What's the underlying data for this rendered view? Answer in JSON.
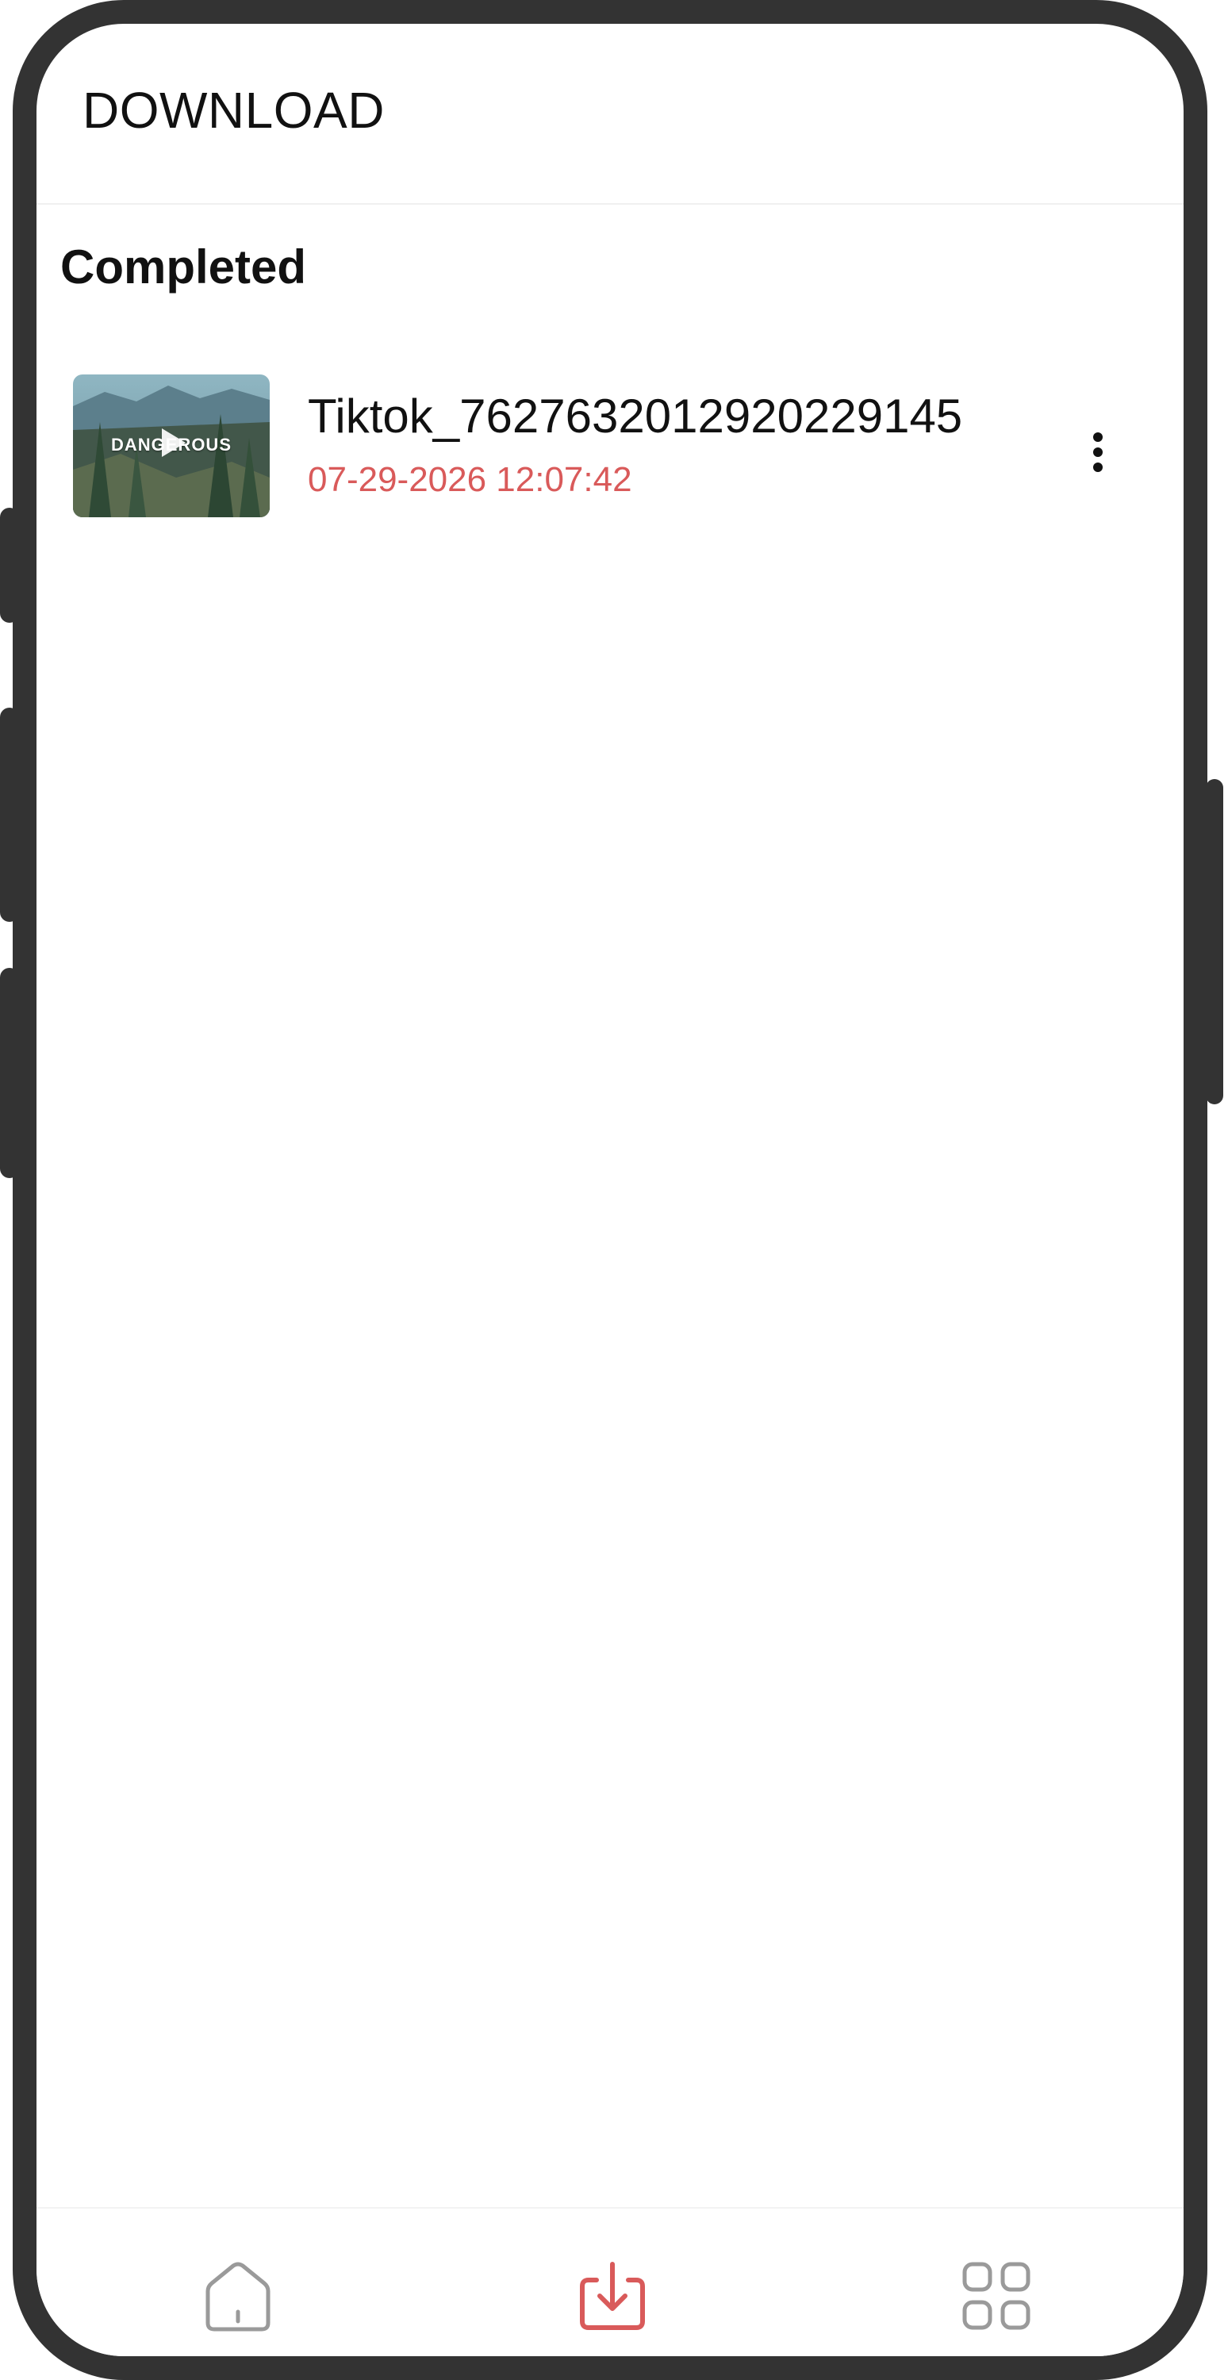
{
  "header": {
    "title": "DOWNLOAD"
  },
  "section": {
    "title": "Completed"
  },
  "downloads": [
    {
      "file_name": "Tiktok_7627632012920229145",
      "date": "07-29-2026 12:07:42",
      "thumbnail_text": "DANGEROUS",
      "thumbnail_icon": "play-icon"
    }
  ],
  "bottom_nav": {
    "items": [
      {
        "name": "home",
        "icon": "home-icon",
        "active": false
      },
      {
        "name": "download",
        "icon": "download-icon",
        "active": true
      },
      {
        "name": "apps",
        "icon": "grid-icon",
        "active": false
      }
    ]
  },
  "colors": {
    "accent": "#d95a5a",
    "inactive_icon": "#9a9a9a",
    "frame": "#333333"
  }
}
